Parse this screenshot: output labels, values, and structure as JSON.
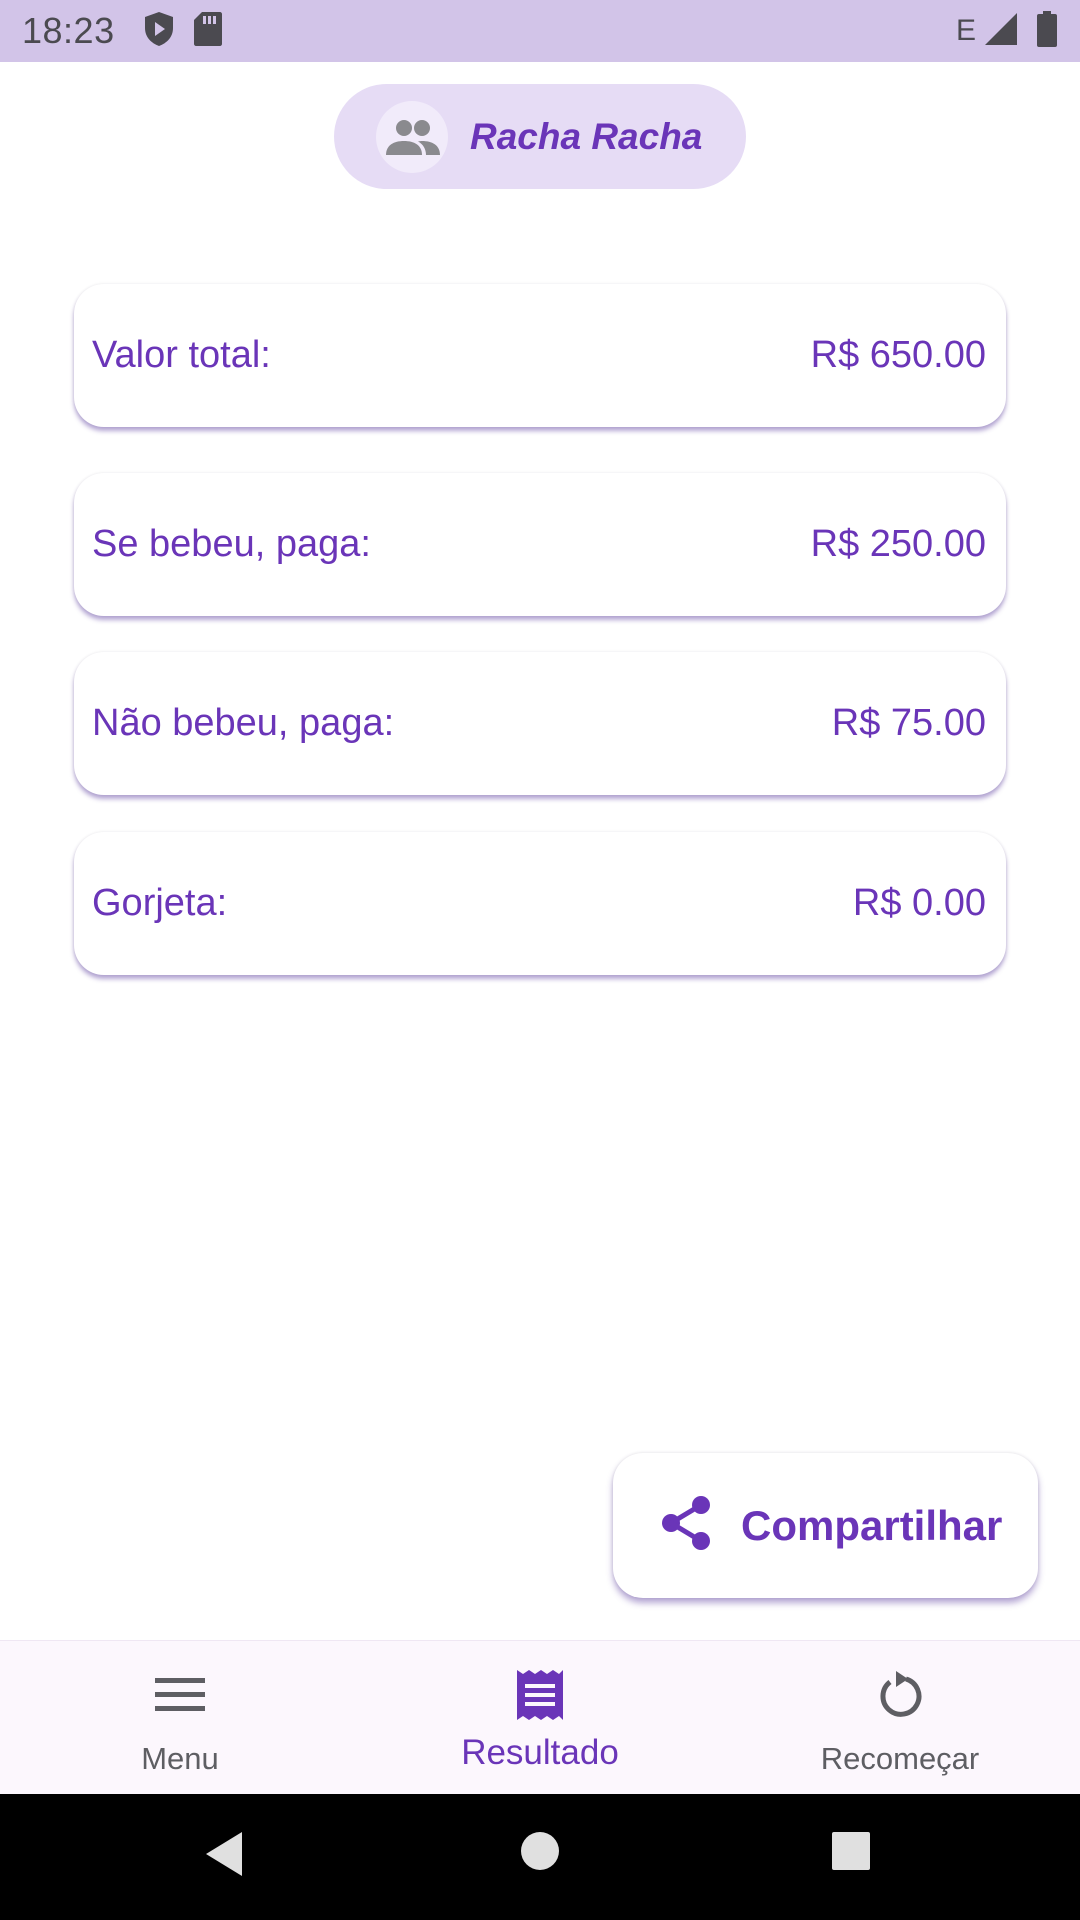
{
  "status_bar": {
    "time": "18:23",
    "network": "E",
    "icons": [
      "shield-play-icon",
      "sd-card-icon",
      "signal-icon",
      "battery-icon"
    ]
  },
  "app": {
    "title": "Racha Racha",
    "title_icon": "group-icon"
  },
  "results": [
    {
      "label": "Valor total:",
      "value": "R$ 650.00"
    },
    {
      "label": "Se bebeu, paga:",
      "value": "R$ 250.00"
    },
    {
      "label": "Não bebeu, paga:",
      "value": "R$ 75.00"
    },
    {
      "label": "Gorjeta:",
      "value": "R$ 0.00"
    }
  ],
  "share_button": {
    "label": "Compartilhar",
    "icon": "share-icon"
  },
  "bottom_nav": {
    "items": [
      {
        "label": "Menu",
        "icon": "menu-icon",
        "active": false
      },
      {
        "label": "Resultado",
        "icon": "receipt-icon",
        "active": true
      },
      {
        "label": "Recomeçar",
        "icon": "restart-icon",
        "active": false
      }
    ]
  },
  "colors": {
    "accent": "#6a35b8",
    "status_bar_bg": "#d2c4e8",
    "title_pill_bg": "#e6dcf5",
    "nav_bg": "#fcf7fd"
  }
}
